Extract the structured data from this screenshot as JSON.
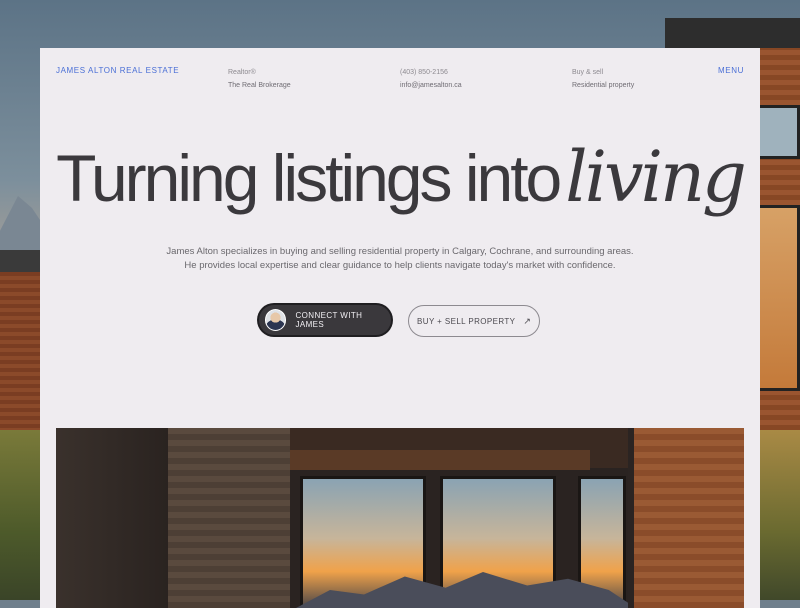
{
  "header": {
    "brand": "JAMES ALTON REAL ESTATE",
    "meta": [
      {
        "label": "Realtor®",
        "value": "The Real Brokerage"
      },
      {
        "label": "(403) 850-2156",
        "value": "info@jamesalton.ca"
      },
      {
        "label": "Buy & sell",
        "value": "Residential property"
      }
    ],
    "menu_label": "MENU"
  },
  "hero": {
    "headline": "Turning listings into",
    "headline_em": "living",
    "description_line1": "James Alton specializes in buying and selling residential property in Calgary, Cochrane, and surrounding areas.",
    "description_line2": "He provides local expertise and clear guidance to help clients navigate today's market with confidence."
  },
  "buttons": {
    "connect": "CONNECT WITH JAMES",
    "buy_sell": "BUY + SELL PROPERTY",
    "buy_sell_icon": "arrow-up-right-icon"
  },
  "colors": {
    "accent": "#4a6fd6",
    "card_bg": "#efecf0",
    "dark_button": "#3a383c"
  }
}
